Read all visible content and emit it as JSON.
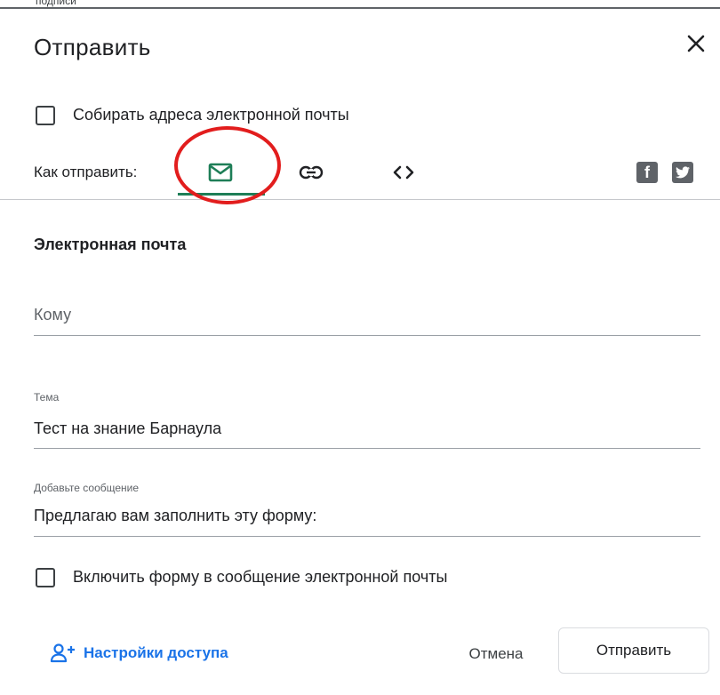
{
  "window": {
    "partial_text": "подписи"
  },
  "dialog": {
    "title": "Отправить",
    "close_icon": "close-icon"
  },
  "collect_emails": {
    "label": "Собирать адреса электронной почты",
    "checked": false
  },
  "send_via": {
    "label": "Как отправить:",
    "tabs": [
      {
        "name": "email",
        "icon": "mail-icon",
        "active": true
      },
      {
        "name": "link",
        "icon": "link-icon",
        "active": false
      },
      {
        "name": "embed",
        "icon": "code-icon",
        "active": false
      }
    ],
    "social": [
      {
        "name": "facebook",
        "icon": "facebook-icon",
        "glyph": "f"
      },
      {
        "name": "twitter",
        "icon": "twitter-icon"
      }
    ]
  },
  "email_section": {
    "title": "Электронная почта",
    "to": {
      "placeholder": "Кому",
      "value": ""
    },
    "subject": {
      "label": "Тема",
      "value": "Тест на знание Барнаула"
    },
    "message": {
      "label": "Добавьте сообщение",
      "value": "Предлагаю вам заполнить эту форму:"
    },
    "include_form": {
      "label": "Включить форму в сообщение электронной почты",
      "checked": false
    }
  },
  "footer": {
    "access_settings": "Настройки доступа",
    "cancel": "Отмена",
    "send": "Отправить"
  },
  "colors": {
    "accent_green": "#1e7e57",
    "link_blue": "#1a73e8",
    "annotation_red": "#e21d1d"
  }
}
